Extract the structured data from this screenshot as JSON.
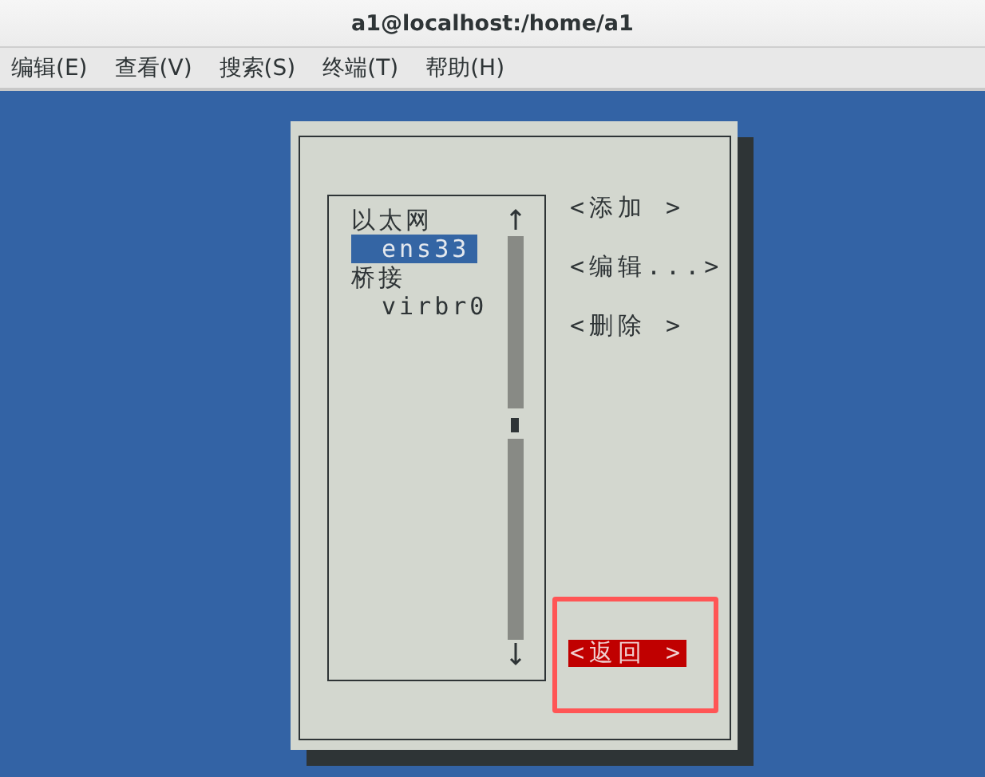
{
  "window": {
    "title": "a1@localhost:/home/a1"
  },
  "menu": [
    {
      "label": "编辑(E)"
    },
    {
      "label": "查看(V)"
    },
    {
      "label": "搜索(S)"
    },
    {
      "label": "终端(T)"
    },
    {
      "label": "帮助(H)"
    }
  ],
  "connections": [
    {
      "kind": "group",
      "label": "以太网",
      "selected": false
    },
    {
      "kind": "device",
      "label": "ens33",
      "selected": true
    },
    {
      "kind": "group",
      "label": "桥接",
      "selected": false
    },
    {
      "kind": "device",
      "label": "virbr0",
      "selected": false
    }
  ],
  "buttons": [
    {
      "label": "<添加 >",
      "selected": false
    },
    {
      "label": "<编辑...>",
      "selected": false
    },
    {
      "label": "<删除 >",
      "selected": false
    }
  ],
  "back_button": {
    "label": "<返回 >",
    "selected": true
  }
}
